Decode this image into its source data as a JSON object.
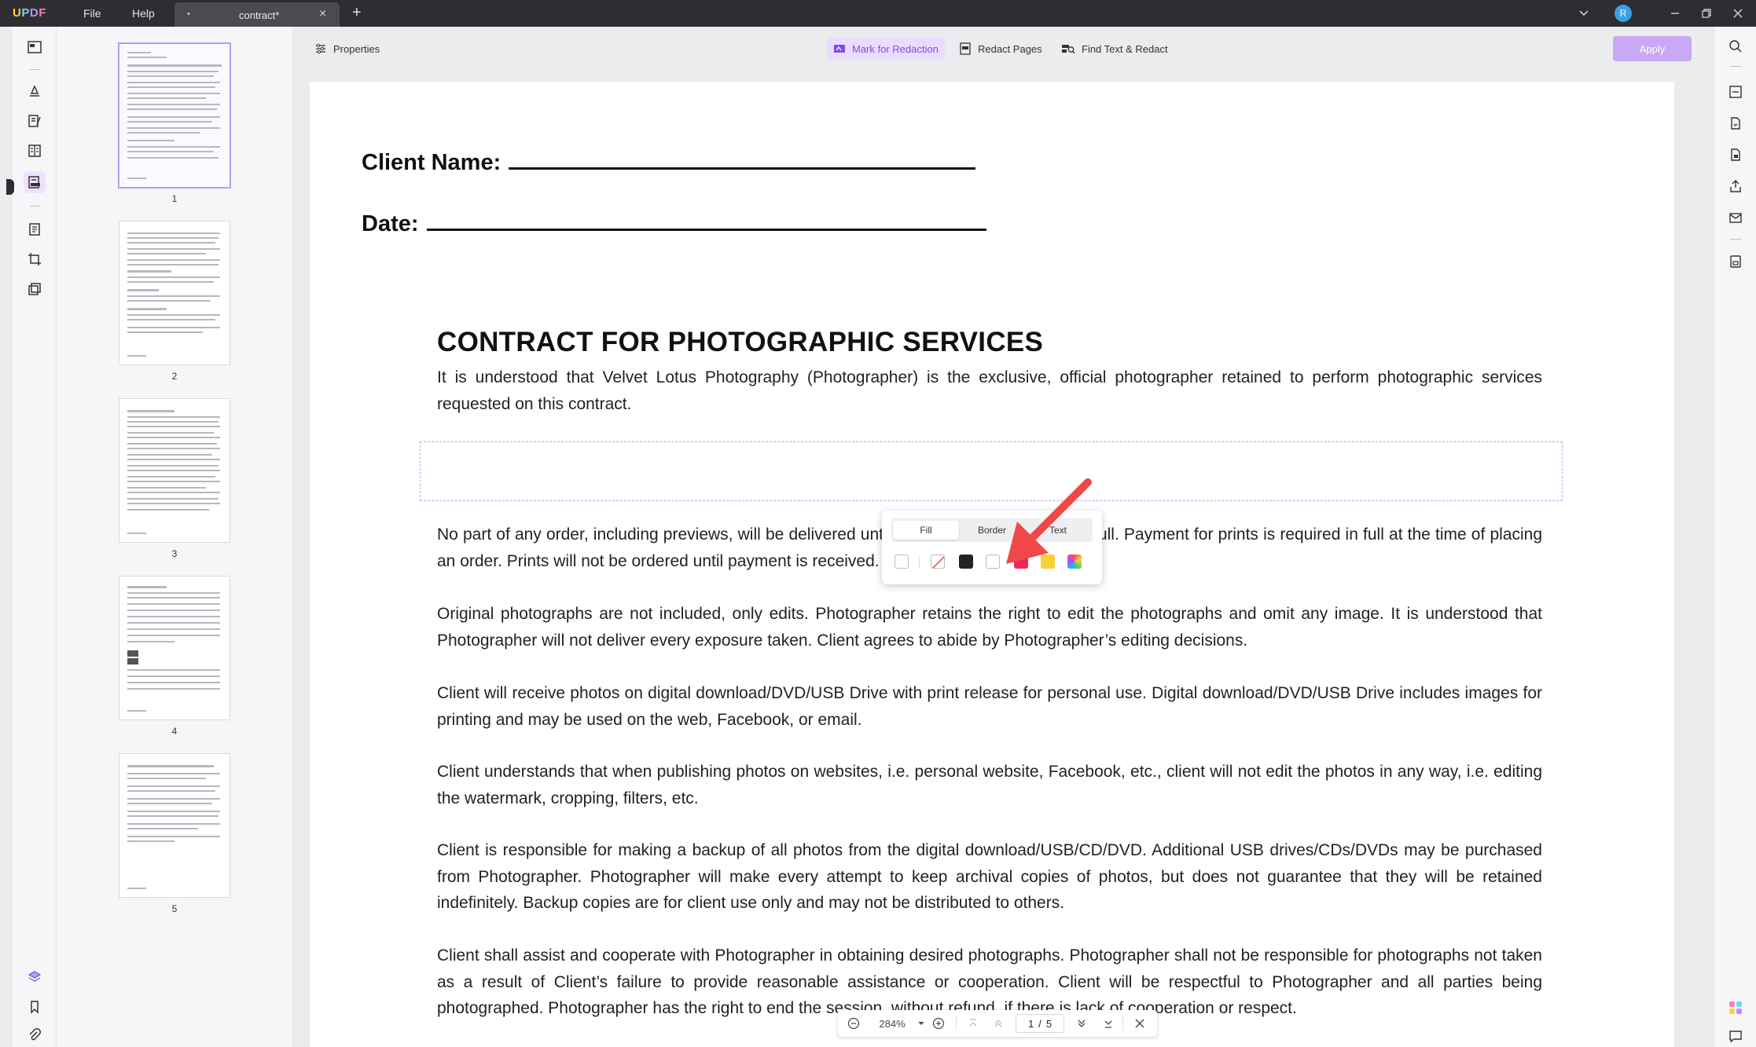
{
  "app": {
    "logo": {
      "u": "U",
      "p": "P",
      "d": "D",
      "f": "F"
    },
    "menu": {
      "file": "File",
      "help": "Help"
    },
    "tab": {
      "dot": "•",
      "label": "contract*",
      "close": "×"
    },
    "new_tab": "+",
    "avatar_initial": "R"
  },
  "toolbar": {
    "properties": "Properties",
    "mark_for_redaction": "Mark for Redaction",
    "redact_pages": "Redact Pages",
    "find_text_redact": "Find Text & Redact",
    "apply": "Apply"
  },
  "thumbnails": {
    "numbers": [
      "1",
      "2",
      "3",
      "4",
      "5"
    ],
    "selected": "1"
  },
  "document": {
    "client_name_label": "Client Name:",
    "date_label": "Date:",
    "title": "CONTRACT FOR PHOTOGRAPHIC SERVICES",
    "paragraphs": [
      "It is understood that Velvet Lotus Photography (Photographer) is the exclusive, official photographer retained to perform photographic services requested on this contract.",
      "No part of any order, including previews, will be delivered until the order has been paid in full. Payment for prints is required in full at the time of placing an order. Prints will not be ordered until payment is received.",
      "Original photographs are not included, only edits. Photographer retains the right to edit the photographs and omit any image. It is understood that Photographer will not deliver every exposure taken. Client agrees to abide by Photographer’s editing decisions.",
      "Client will receive photos on digital download/DVD/USB Drive with print release for personal use. Digital download/DVD/USB Drive includes images for printing and may be used on the web, Facebook, or email.",
      "Client understands that when publishing photos on websites, i.e. personal website, Facebook, etc., client will not edit the photos in any way, i.e. editing the watermark, cropping, filters, etc.",
      "Client is responsible for making a backup of all photos from the digital download/USB/CD/DVD. Additional USB drives/CDs/DVDs may be purchased from Photographer. Photographer will make every attempt to keep archival copies of photos, but does not guarantee that they will be retained indefinitely. Backup copies are for client use only and may not be distributed to others.",
      "Client shall assist and cooperate with Photographer in obtaining desired photographs. Photographer shall not be responsible for photographs not taken as a result of Client’s failure to provide reasonable assistance or cooperation. Client will be respectful to Photographer and all parties being photographed. Photographer has the right to end the session, without refund, if there is lack of cooperation or respect."
    ]
  },
  "color_popup": {
    "tabs": {
      "fill": "Fill",
      "border": "Border",
      "text": "Text"
    },
    "active_tab": "Fill",
    "swatches": {
      "white": "#ffffff",
      "black": "#222222",
      "red": "#f0285a",
      "yellow": "#f8d033",
      "accent_arrow": "#f04848"
    }
  },
  "bottom_nav": {
    "zoom": "284%",
    "current_page": "1",
    "separator": "/",
    "total_pages": "5"
  },
  "colors": {
    "accent": "#7a4fe0",
    "accent_light": "#eadcff",
    "apply_bg": "#c9a9f5"
  }
}
